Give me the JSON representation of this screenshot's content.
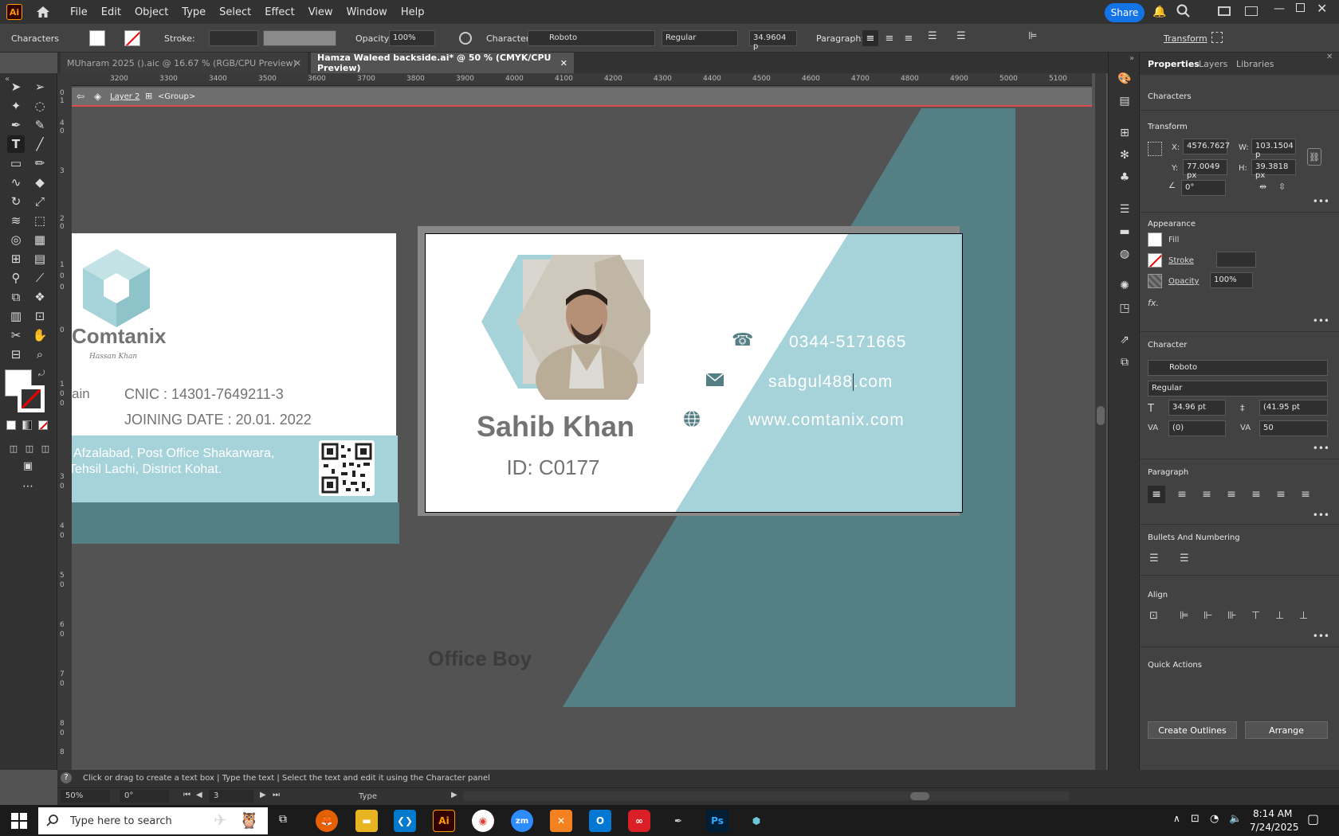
{
  "app": {
    "logo": "Ai",
    "menus": [
      "File",
      "Edit",
      "Object",
      "Type",
      "Select",
      "Effect",
      "View",
      "Window",
      "Help"
    ],
    "share_label": "Share"
  },
  "control_bar": {
    "mode_label": "Characters",
    "stroke_label": "Stroke:",
    "opacity_label": "Opacity:",
    "opacity_value": "100%",
    "character_label": "Character:",
    "font_value": "Roboto",
    "style_value": "Regular",
    "size_value": "34.9604 p",
    "paragraph_label": "Paragraph:",
    "transform_label": "Transform"
  },
  "tabs": [
    {
      "label": "MUharam 2025 ().aic @ 16.67 % (RGB/CPU Preview)"
    },
    {
      "label": "Hamza Waleed backside.ai* @ 50 % (CMYK/CPU Preview)"
    }
  ],
  "ruler": {
    "top": [
      "3200",
      "3300",
      "3400",
      "3500",
      "3600",
      "3700",
      "3800",
      "3900",
      "4000",
      "4100",
      "4200",
      "4300",
      "4400",
      "4500",
      "4600",
      "4700",
      "4800",
      "4900",
      "5000",
      "5100"
    ],
    "left": [
      "0",
      "1",
      "4",
      "0",
      "3",
      "2",
      "0",
      "1",
      "0",
      "0",
      "0",
      "1",
      "0",
      "0",
      "3",
      "0",
      "4",
      "0",
      "5",
      "0",
      "6",
      "0",
      "7",
      "0",
      "8",
      "0",
      "8"
    ]
  },
  "isolation_bar": {
    "layer": "Layer 2",
    "group": "<Group>"
  },
  "card_back": {
    "brand": "Comtanix",
    "signature": "Hassan Khan",
    "partial_text": "ain",
    "cnic": "CNIC : 14301-7649211-3",
    "joining": "JOINING DATE : 20.01. 2022",
    "address_line1": "Afzalabad, Post Office Shakarwara,",
    "address_line2": "Tehsil Lachi, District Kohat."
  },
  "card_front": {
    "name": "Sahib Khan",
    "id": "ID: C0177",
    "phone": "0344-5171665",
    "email_before": "sabgul488",
    "email_after": ".com",
    "website": "www.comtanix.com"
  },
  "offcanvas_text": "Office Boy",
  "panel": {
    "tabs": [
      "Properties",
      "Layers",
      "Libraries"
    ],
    "section_characters": "Characters",
    "transform_title": "Transform",
    "x_label": "X:",
    "x_value": "4576.7627",
    "y_label": "Y:",
    "y_value": "77.0049 px",
    "w_label": "W:",
    "w_value": "103.1504 p",
    "h_label": "H:",
    "h_value": "39.3818 px",
    "angle_value": "0°",
    "appearance_title": "Appearance",
    "fill_label": "Fill",
    "stroke_label": "Stroke",
    "opacity_label": "Opacity",
    "opacity_value": "100%",
    "fx_label": "fx.",
    "character_title": "Character",
    "font": "Roboto",
    "style": "Regular",
    "size": "34.96 pt",
    "leading": "(41.95 pt",
    "kerning": "(0)",
    "tracking": "50",
    "paragraph_title": "Paragraph",
    "bullets_title": "Bullets And Numbering",
    "align_title": "Align",
    "quick_actions_title": "Quick Actions",
    "create_outlines": "Create Outlines",
    "arrange": "Arrange"
  },
  "status": {
    "hint": "Click or drag to create a text box  |  Type the text  |  Select the text and edit it using the Character panel",
    "zoom": "50%",
    "rotate": "0°",
    "artboard": "3",
    "tool_name": "Type"
  },
  "taskbar": {
    "search_placeholder": "Type here to search",
    "time": "8:14 AM",
    "date": "7/24/2025"
  },
  "colors": {
    "teal_light": "#a6d3d9",
    "teal_dark": "#547f85",
    "text_gray": "#737373",
    "accent_blue": "#1473e6"
  }
}
